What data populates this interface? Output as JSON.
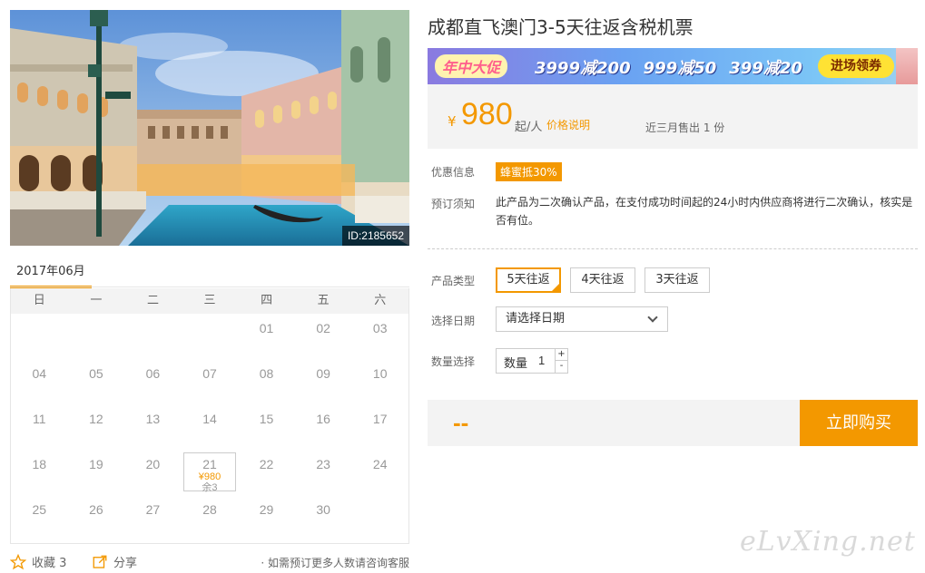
{
  "product": {
    "title": "成都直飞澳门3-5天往返含税机票",
    "photo_id": "ID:2185652"
  },
  "promo": {
    "title": "年中大促",
    "offers": [
      "3999减200",
      "999减50",
      "399减20"
    ],
    "cta": "进场领券",
    "colors": {
      "accent": "#f39800",
      "cta_bg": "#ffe234"
    }
  },
  "pricing": {
    "currency": "¥",
    "price": "980",
    "unit": "起/人",
    "explain_link": "价格说明",
    "sold": "近三月售出 1 份"
  },
  "info": {
    "discount_label": "优惠信息",
    "discount_tag": "蜂蜜抵30%",
    "notice_label": "预订须知",
    "notice_text": "此产品为二次确认产品，在支付成功时间起的24小时内供应商将进行二次确认，核实是否有位。"
  },
  "options": {
    "type_label": "产品类型",
    "types": [
      "5天往返",
      "4天往返",
      "3天往返"
    ],
    "selected_type": "5天往返",
    "date_label": "选择日期",
    "date_placeholder": "请选择日期",
    "qty_label": "数量选择",
    "qty_prefix": "数量",
    "qty_value": "1",
    "plus": "+",
    "minus": "-"
  },
  "buy": {
    "total": "--",
    "button": "立即购买"
  },
  "calendar": {
    "month": "2017年06月",
    "weekdays": [
      "日",
      "一",
      "二",
      "三",
      "四",
      "五",
      "六"
    ],
    "days": [
      "",
      "",
      "",
      "",
      "01",
      "02",
      "03",
      "04",
      "05",
      "06",
      "07",
      "08",
      "09",
      "10",
      "11",
      "12",
      "13",
      "14",
      "15",
      "16",
      "17",
      "18",
      "19",
      "20",
      "21",
      "22",
      "23",
      "24",
      "25",
      "26",
      "27",
      "28",
      "29",
      "30",
      ""
    ],
    "available": {
      "day": "21",
      "price": "¥980",
      "stock": "余3"
    }
  },
  "footer": {
    "favorite": "收藏 3",
    "share": "分享",
    "note": "· 如需预订更多人数请咨询客服"
  },
  "watermark": "eLvXing.net"
}
